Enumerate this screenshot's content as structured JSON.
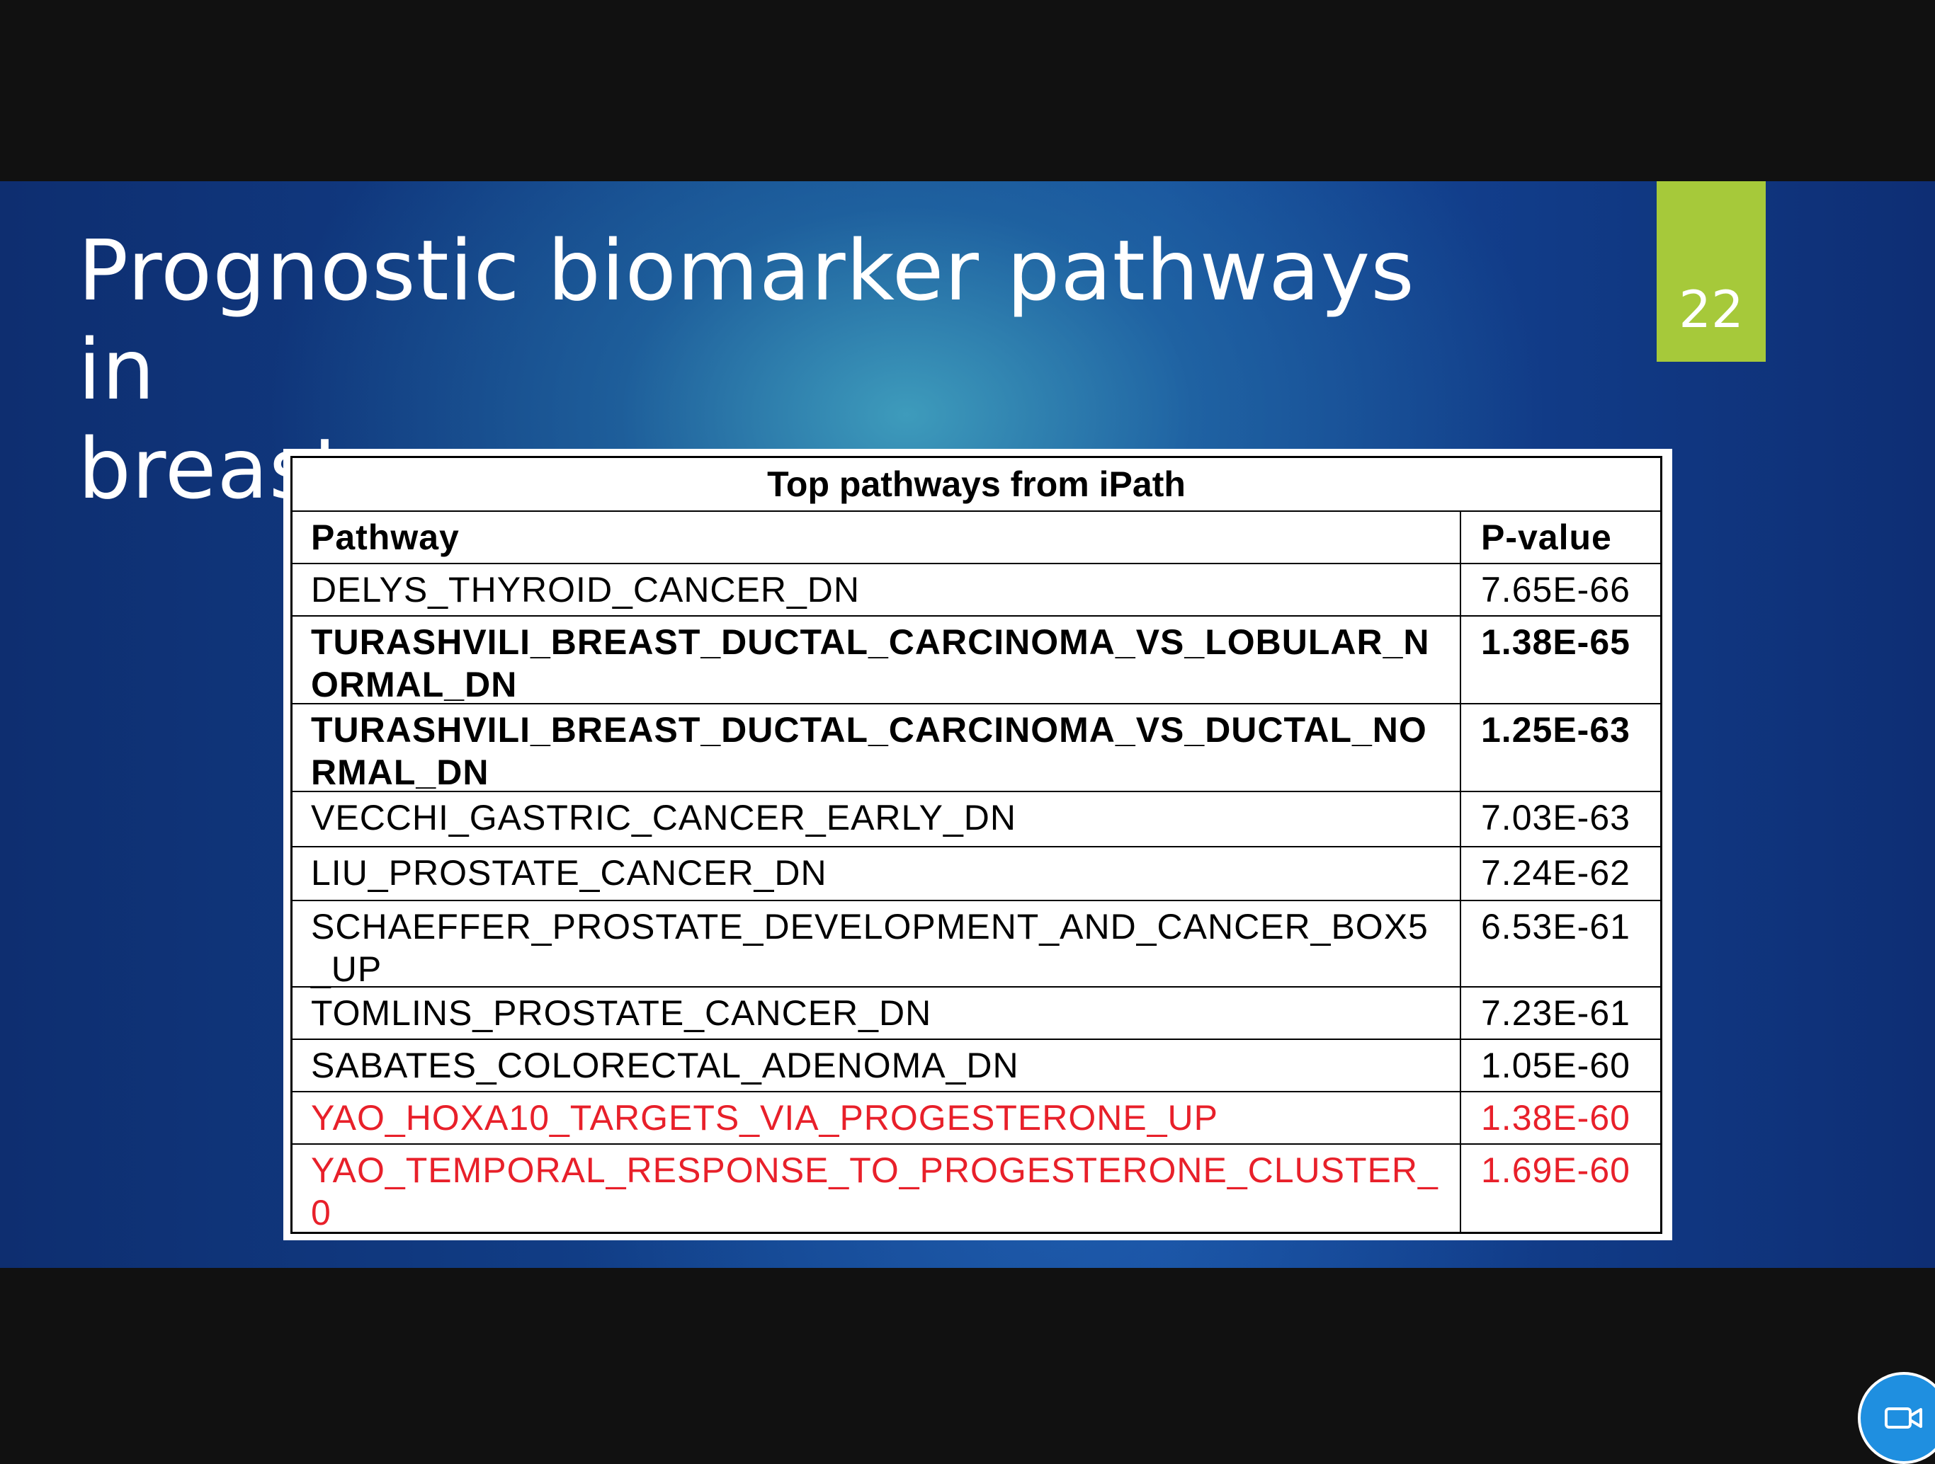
{
  "slide": {
    "title_line1": "Prognostic biomarker pathways in",
    "title_line2": "breast cancer",
    "page_number": "22"
  },
  "table": {
    "caption": "Top pathways from iPath",
    "headers": {
      "pathway": "Pathway",
      "pvalue": "P-value"
    },
    "rows": [
      {
        "pathway": "DELYS_THYROID_CANCER_DN",
        "pvalue": "7.65E-66",
        "style": "normal"
      },
      {
        "pathway": "TURASHVILI_BREAST_DUCTAL_CARCINOMA_VS_LOBULAR_NORMAL_DN",
        "pvalue": "1.38E-65",
        "style": "bold"
      },
      {
        "pathway": "TURASHVILI_BREAST_DUCTAL_CARCINOMA_VS_DUCTAL_NORMAL_DN",
        "pvalue": "1.25E-63",
        "style": "bold"
      },
      {
        "pathway": "VECCHI_GASTRIC_CANCER_EARLY_DN",
        "pvalue": "7.03E-63",
        "style": "normal"
      },
      {
        "pathway": "LIU_PROSTATE_CANCER_DN",
        "pvalue": "7.24E-62",
        "style": "normal"
      },
      {
        "pathway": "SCHAEFFER_PROSTATE_DEVELOPMENT_AND_CANCER_BOX5_UP",
        "pvalue": "6.53E-61",
        "style": "normal"
      },
      {
        "pathway": "TOMLINS_PROSTATE_CANCER_DN",
        "pvalue": "7.23E-61",
        "style": "normal"
      },
      {
        "pathway": "SABATES_COLORECTAL_ADENOMA_DN",
        "pvalue": "1.05E-60",
        "style": "normal"
      },
      {
        "pathway": "YAO_HOXA10_TARGETS_VIA_PROGESTERONE_UP",
        "pvalue": "1.38E-60",
        "style": "red"
      },
      {
        "pathway": "YAO_TEMPORAL_RESPONSE_TO_PROGESTERONE_CLUSTER_0",
        "pvalue": "1.69E-60",
        "style": "red"
      }
    ]
  },
  "controls": {
    "camera_icon": "video-camera-icon",
    "accent_color": "#a6c93a",
    "highlight_color": "#e8202a"
  }
}
